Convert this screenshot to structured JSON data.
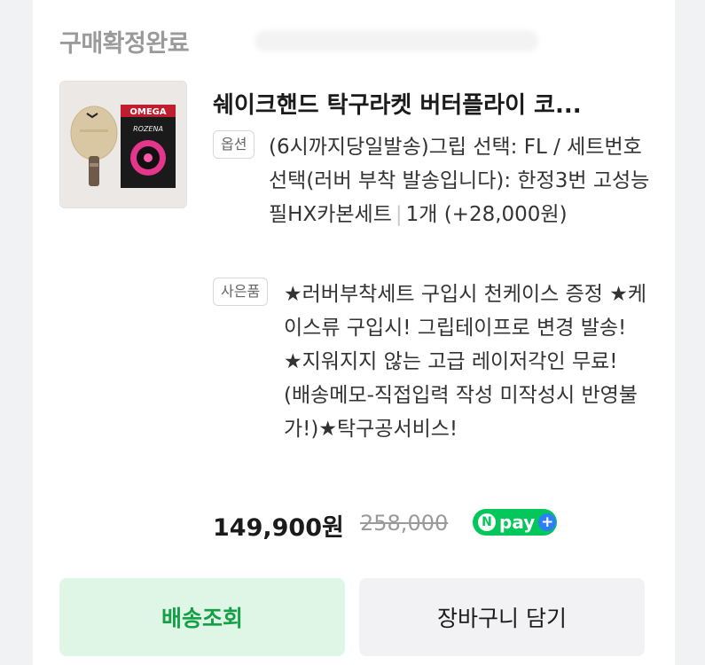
{
  "order": {
    "status": "구매확정완료",
    "product_title": "쉐이크핸드 탁구라켓 버터플라이 코...",
    "option_tag": "옵션",
    "option_text": "(6시까지당일발송)그립 선택: FL / 세트번호 선택(러버 부착 발송입니다): 한정3번 고성능 필HX카본세트",
    "option_separator": "|",
    "option_qty": "1개 (+28,000원)",
    "gift_tag": "사은품",
    "gift_text": "★러버부착세트 구입시 천케이스 증정 ★케이스류 구입시! 그립테이프로 변경 발송! ★지워지지 않는 고급 레이저각인 무료! (배송메모-직접입력 작성 미작성시 반영불가!)★탁구공서비스!",
    "price": "149,900원",
    "original_price": "258,000",
    "npay_label": "pay",
    "npay_n": "N",
    "npay_plus": "+"
  },
  "product_image": {
    "box_brand": "OMEGA",
    "box_model": "ROZENA"
  },
  "actions": {
    "track_label": "배송조회",
    "cart_label": "장바구니 담기"
  },
  "colors": {
    "npay_green": "#03c75a",
    "track_button_bg": "#dff5e6",
    "track_button_text": "#14a047"
  }
}
